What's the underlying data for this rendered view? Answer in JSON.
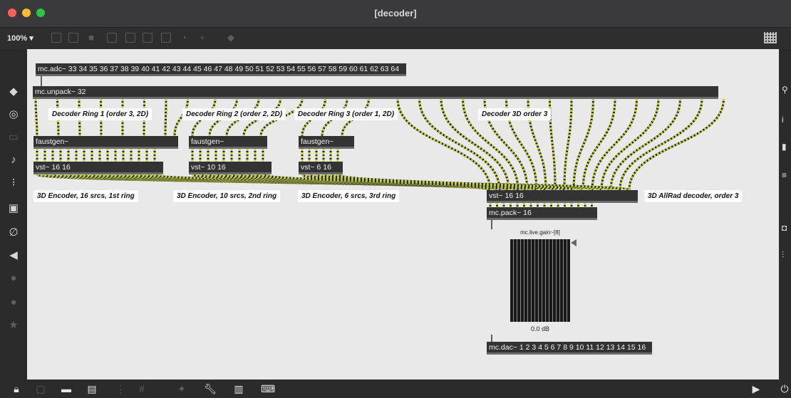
{
  "window": {
    "title": "[decoder]"
  },
  "toolbar": {
    "zoom": "100% ▾"
  },
  "objects": {
    "adc": "mc.adc~ 33 34 35 36 37 38 39 40 41 42 43 44 45 46 47 48 49 50 51 52 53 54 55 56 57 58 59 60 61 62 63 64",
    "unpack": "mc.unpack~ 32",
    "faustgen1": "faustgen~",
    "faustgen2": "faustgen~",
    "faustgen3": "faustgen~",
    "vst1": "vst~ 16 16",
    "vst2": "vst~ 10 16",
    "vst3": "vst~ 6 16",
    "vst_decoder": "vst~ 16 16",
    "pack": "mc.pack~ 16",
    "dac": "mc.dac~ 1 2 3 4 5 6 7 8 9 10 11 12 13 14 15 16"
  },
  "comments": {
    "ring1": "Decoder Ring 1 (order 3, 2D)",
    "ring2": "Decoder Ring 2 (order 2, 2D)",
    "ring3": "Decoder Ring 3 (order 1, 2D)",
    "decoder3d": "Decoder 3D order 3",
    "enc1": "3D Encoder, 16 srcs, 1st ring",
    "enc2": "3D Encoder, 10 srcs, 2nd ring",
    "enc3": "3D Encoder, 6 srcs, 3rd ring",
    "allrad": "3D AllRad decoder, order 3"
  },
  "gain": {
    "label": "mc.live.gain~[8]",
    "value": "0.0 dB"
  },
  "icons": {
    "left": [
      "cube-icon",
      "target-icon",
      "film-icon",
      "music-note-icon",
      "playlist-icon",
      "image-icon",
      "paperclip-icon",
      "plug-icon",
      "v-circle-icon",
      "b-circle-icon",
      "star-icon"
    ],
    "right": [
      "search-icon",
      "info-icon",
      "columns-icon",
      "list-icon",
      "camera-icon",
      "sliders-icon"
    ],
    "bottom": [
      "lock-icon",
      "present-icon",
      "chat-icon",
      "layers-icon",
      "grid-icon",
      "wrench-icon",
      "piano-icon",
      "keyboard-icon",
      "play-icon",
      "power-icon"
    ]
  },
  "colors": {
    "canvas": "#e9e9e9",
    "object": "#333333",
    "cable": "#c6d44a"
  }
}
